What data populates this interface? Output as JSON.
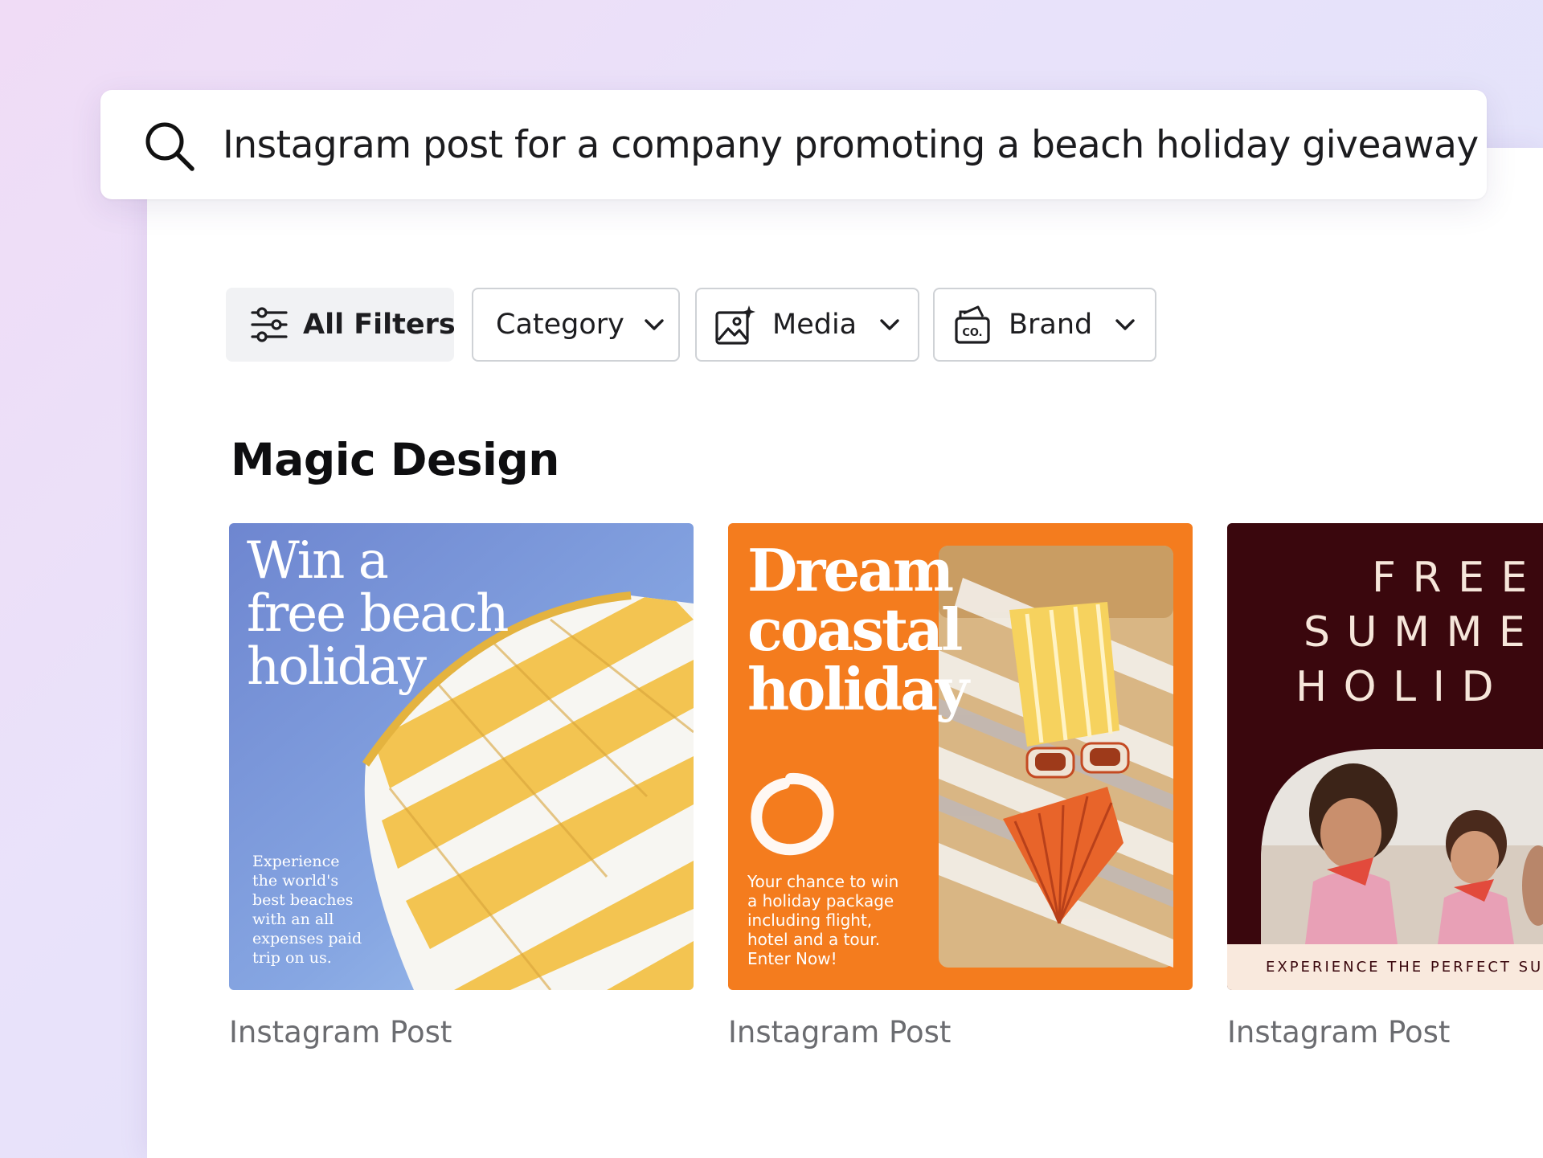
{
  "search": {
    "query": "Instagram post for a company promoting a beach holiday giveaway"
  },
  "filters": {
    "all_filters_label": "All Filters",
    "category_label": "Category",
    "media_label": "Media",
    "brand_label": "Brand"
  },
  "section": {
    "title": "Magic Design"
  },
  "cards": [
    {
      "headline_lines": [
        "Win a",
        "free beach",
        "holiday"
      ],
      "body_lines": [
        "Experience",
        "the world's",
        "best beaches",
        "with an all",
        "expenses paid",
        "trip on us."
      ],
      "label": "Instagram Post",
      "colors": {
        "background": "#7f9fe0",
        "stripe_yellow": "#f3c451"
      }
    },
    {
      "headline_lines": [
        "Dream",
        "coastal",
        "holiday"
      ],
      "body_lines": [
        "Your chance to win",
        "a holiday package",
        "including flight,",
        "hotel and a tour.",
        "Enter Now!"
      ],
      "label": "Instagram Post",
      "colors": {
        "background": "#f47c1e"
      }
    },
    {
      "headline_lines": [
        "F R E E",
        "S U M M E",
        "H O L I D"
      ],
      "footer_text": "EXPERIENCE THE PERFECT SUM",
      "label": "Instagram Post",
      "colors": {
        "background": "#3a070d",
        "footer": "#f9e9dd"
      }
    }
  ],
  "icons": [
    "search-icon",
    "sliders-icon",
    "chevron-down-icon",
    "image-sparkle-icon",
    "brand-kit-icon"
  ]
}
